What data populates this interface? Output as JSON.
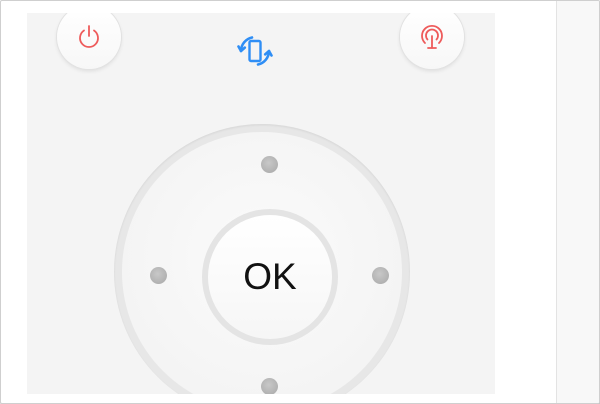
{
  "colors": {
    "panel_background": "#f4f4f4",
    "power_icon": "#ee5b5b",
    "cast_icon": "#ee5b5b",
    "rotate_icon": "#2f8ef5",
    "ok_text": "#111111",
    "dpad_dot": "#b5b5b5"
  },
  "top_controls": {
    "power": {
      "icon": "power-icon"
    },
    "rotate": {
      "icon": "screen-rotate-icon"
    },
    "cast": {
      "icon": "cast-broadcast-icon"
    }
  },
  "dpad": {
    "ok_label": "OK",
    "directions": [
      "up",
      "down",
      "left",
      "right"
    ]
  }
}
